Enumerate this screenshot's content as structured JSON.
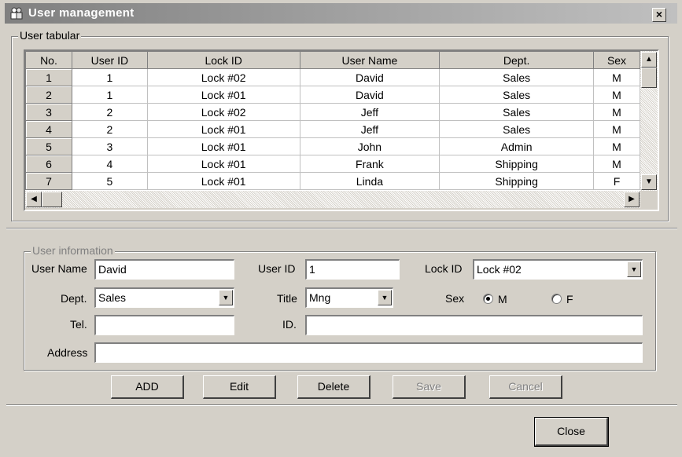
{
  "window": {
    "title": "User management",
    "close_glyph": "×"
  },
  "user_table": {
    "legend": "User tabular",
    "columns": [
      "No.",
      "User ID",
      "Lock ID",
      "User Name",
      "Dept.",
      "Sex"
    ],
    "rows": [
      [
        "1",
        "1",
        "Lock #02",
        "David",
        "Sales",
        "M"
      ],
      [
        "2",
        "1",
        "Lock #01",
        "David",
        "Sales",
        "M"
      ],
      [
        "3",
        "2",
        "Lock #02",
        "Jeff",
        "Sales",
        "M"
      ],
      [
        "4",
        "2",
        "Lock #01",
        "Jeff",
        "Sales",
        "M"
      ],
      [
        "5",
        "3",
        "Lock #01",
        "John",
        "Admin",
        "M"
      ],
      [
        "6",
        "4",
        "Lock #01",
        "Frank",
        "Shipping",
        "M"
      ],
      [
        "7",
        "5",
        "Lock #01",
        "Linda",
        "Shipping",
        "F"
      ]
    ]
  },
  "user_info": {
    "legend": "User information",
    "user_name_label": "User Name",
    "user_name_value": "David",
    "user_id_label": "User ID",
    "user_id_value": "1",
    "lock_id_label": "Lock ID",
    "lock_id_value": "Lock #02",
    "dept_label": "Dept.",
    "dept_value": "Sales",
    "title_label": "Title",
    "title_value": "Mng",
    "sex_label": "Sex",
    "sex_m_label": "M",
    "sex_f_label": "F",
    "sex_selected": "M",
    "tel_label": "Tel.",
    "tel_value": "",
    "id_label": "ID.",
    "id_value": "",
    "address_label": "Address",
    "address_value": ""
  },
  "actions": {
    "add_label": "ADD",
    "edit_label": "Edit",
    "delete_label": "Delete",
    "save_label": "Save",
    "cancel_label": "Cancel"
  },
  "footer": {
    "close_label": "Close"
  },
  "colors": {
    "face": "#d4d0c8",
    "titlebar_start": "#808080",
    "titlebar_end": "#c0c0c0"
  }
}
